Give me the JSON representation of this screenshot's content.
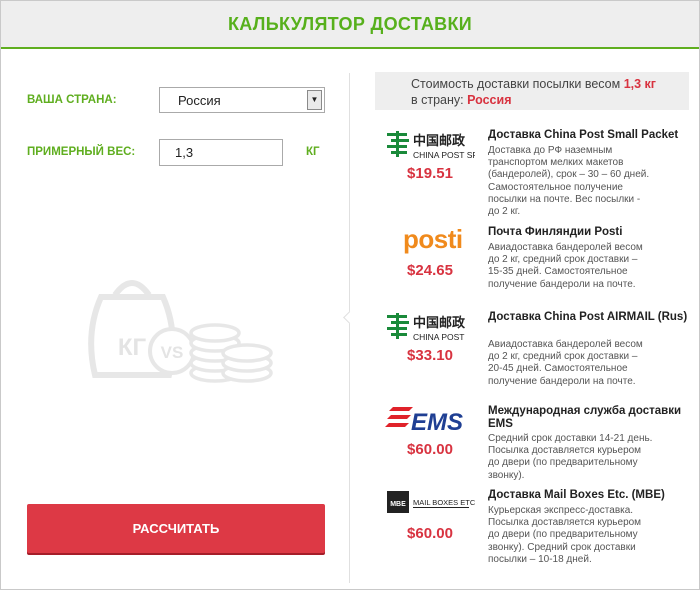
{
  "header": {
    "title": "КАЛЬКУЛЯТОР ДОСТАВКИ"
  },
  "form": {
    "country_label": "ВАША СТРАНА:",
    "country_value": "Россия",
    "weight_label": "ПРИМЕРНЫЙ ВЕС:",
    "weight_value": "1,3",
    "weight_unit": "КГ",
    "calculate_label": "РАССЧИТАТЬ"
  },
  "illustration": {
    "kg_text": "КГ",
    "vs_text": "VS"
  },
  "summary": {
    "prefix": "Стоимость доставки посылки весом",
    "weight": "1,3 кг",
    "country_prefix": "в страну:",
    "country": "Россия"
  },
  "options": [
    {
      "logo_cn": "中国邮政",
      "logo_en": "CHINA POST SP",
      "price": "$19.51",
      "title": "Доставка China Post Small Packet",
      "description": "Доставка до РФ наземным транспортом мелких макетов (бандеролей), срок – 30 – 60 дней. Самостоятельное получение посылки на почте. Вес посылки - до 2 кг."
    },
    {
      "logo_text": "posti",
      "price": "$24.65",
      "title": "Почта Финляндии Posti",
      "description": "Авиадоставка бандеролей весом до 2 кг, средний срок доставки – 15-35 дней. Самостоятельное получение бандероли на почте."
    },
    {
      "logo_cn": "中国邮政",
      "logo_en": "CHINA POST",
      "price": "$33.10",
      "title": "Доставка China Post AIRMAIL (Rus)",
      "description": "Авиадоставка бандеролей весом до 2 кг, средний срок доставки – 20-45 дней. Самостоятельное получение бандероли на почте."
    },
    {
      "logo_text": "EMS",
      "price": "$60.00",
      "title": "Международная служба доставки EMS",
      "description": "Средний срок доставки 14-21 день. Посылка доставляется курьером до двери (по предварительному звонку)."
    },
    {
      "logo_mark": "MBE",
      "logo_text": "MAIL BOXES ETC.",
      "price": "$60.00",
      "title": "Доставка Mail Boxes Etc. (MBE)",
      "description": "Курьерская экспресс-доставка. Посылка доставляется курьером до двери (по предварительному звонку). Средний срок доставки посылки – 10-18 дней."
    }
  ],
  "colors": {
    "green": "#5fae1f",
    "red": "#dd3945",
    "price_red": "#d83340",
    "china_post_green": "#1a8a3a",
    "posti_orange": "#f08a1c"
  }
}
